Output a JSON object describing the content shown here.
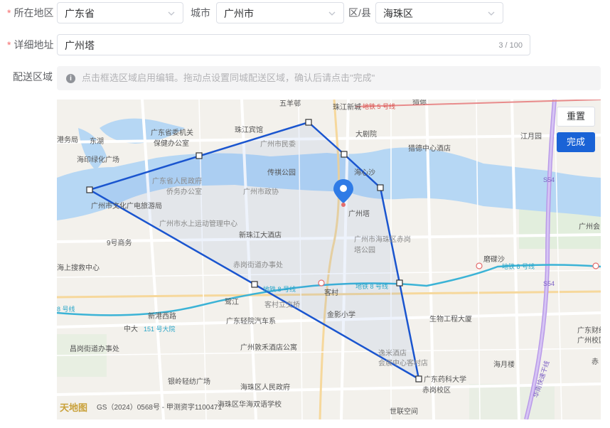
{
  "form": {
    "region_label": "所在地区",
    "province": "广东省",
    "city_label": "城市",
    "city": "广州市",
    "district_label": "区/县",
    "district": "海珠区",
    "address_label": "详细地址",
    "address_value": "广州塔",
    "address_counter": "3 / 100",
    "delivery_label": "配送区域",
    "hint_text": "点击框选区域启用编辑。拖动点设置同城配送区域，确认后请点击\"完成\""
  },
  "map": {
    "reset_label": "重置",
    "done_label": "完成",
    "copyright": "GS（2024）0568号 - 甲测资字1100471",
    "logo_text": "天地图",
    "labels": {
      "wuyangyi": "五羊邨",
      "zhujiang_xincheng": "珠江新城",
      "liede": "猎德",
      "guangdong_weijiguan": "广东省委机关",
      "baojian_bangongshi": "保健办公室",
      "zhujiang_binguan": "珠江宾馆",
      "dajuyuan": "大剧院",
      "jiangyueyuan": "江月园",
      "gangwuju": "港务局",
      "donghu": "东湖",
      "guangzhou_minwei": "广州市民委",
      "liede_zhongxin": "猎德中心酒店",
      "haiyin_lvyou": "海印绿化广场",
      "chuanqi_gongyuan": "传祺公园",
      "haixinsha": "海心沙",
      "qiaowu_bangongshi": "侨务办公室",
      "renmin_zhengfu": "广东省人民政府",
      "zhengxie": "广州市政协",
      "guangzhouta": "广州塔",
      "wenhua_lvyou": "广州市文化广电旅游局",
      "shuishang_yundong": "广州市水上运动管理中心",
      "xingangjiang": "新珠江大酒店",
      "haizhu_chigang": "广州市海珠区赤岗",
      "ta_gongyuan": "塔公园",
      "jiuhao_shangwu": "9号商务",
      "haishang_soujiu": "海上搜救中心",
      "chigang_jiedao": "赤岗街道办事处",
      "mocaosha": "磨碟沙",
      "metro8": "地铁 8 号线",
      "metro5": "地铁 5 号线",
      "kecun": "客村",
      "lujiang": "鹭江",
      "kecun_lijiao": "客村立交桥",
      "jinying_xiaoxue": "金影小学",
      "shengwu_dasha": "生物工程大厦",
      "xingang_xilu": "新港西路",
      "zhongda": "中大",
      "qinggong_qiche": "广东轻院汽车系",
      "line8": "8 号线",
      "line151": "151 号大院",
      "changgang_jiedao": "昌岗街道办事处",
      "dunhe_jiudian": "广州敦禾酒店公寓",
      "yimi_jiudian": "逸米酒店",
      "huiyuan_zhongxin": "会展中心客村店",
      "yaoke_daxue": "广东药科大学",
      "chigang_xiaoqu": "赤岗校区",
      "haiyuelou": "海月楼",
      "yinling_guangchang": "银岭轻纺广场",
      "haizhu_zhengfu": "海珠区人民政府",
      "huayu_xuexiao": "海珠区华海双语学校",
      "shilian_kongjian": "世联空间",
      "huanan_kuaisu": "华南快速干线",
      "s54": "S54",
      "guangzhouhui": "广州会",
      "guangdong_caijing": "广东财经",
      "guangzhou_xiaoqu": "广州校区",
      "chi": "赤"
    }
  }
}
